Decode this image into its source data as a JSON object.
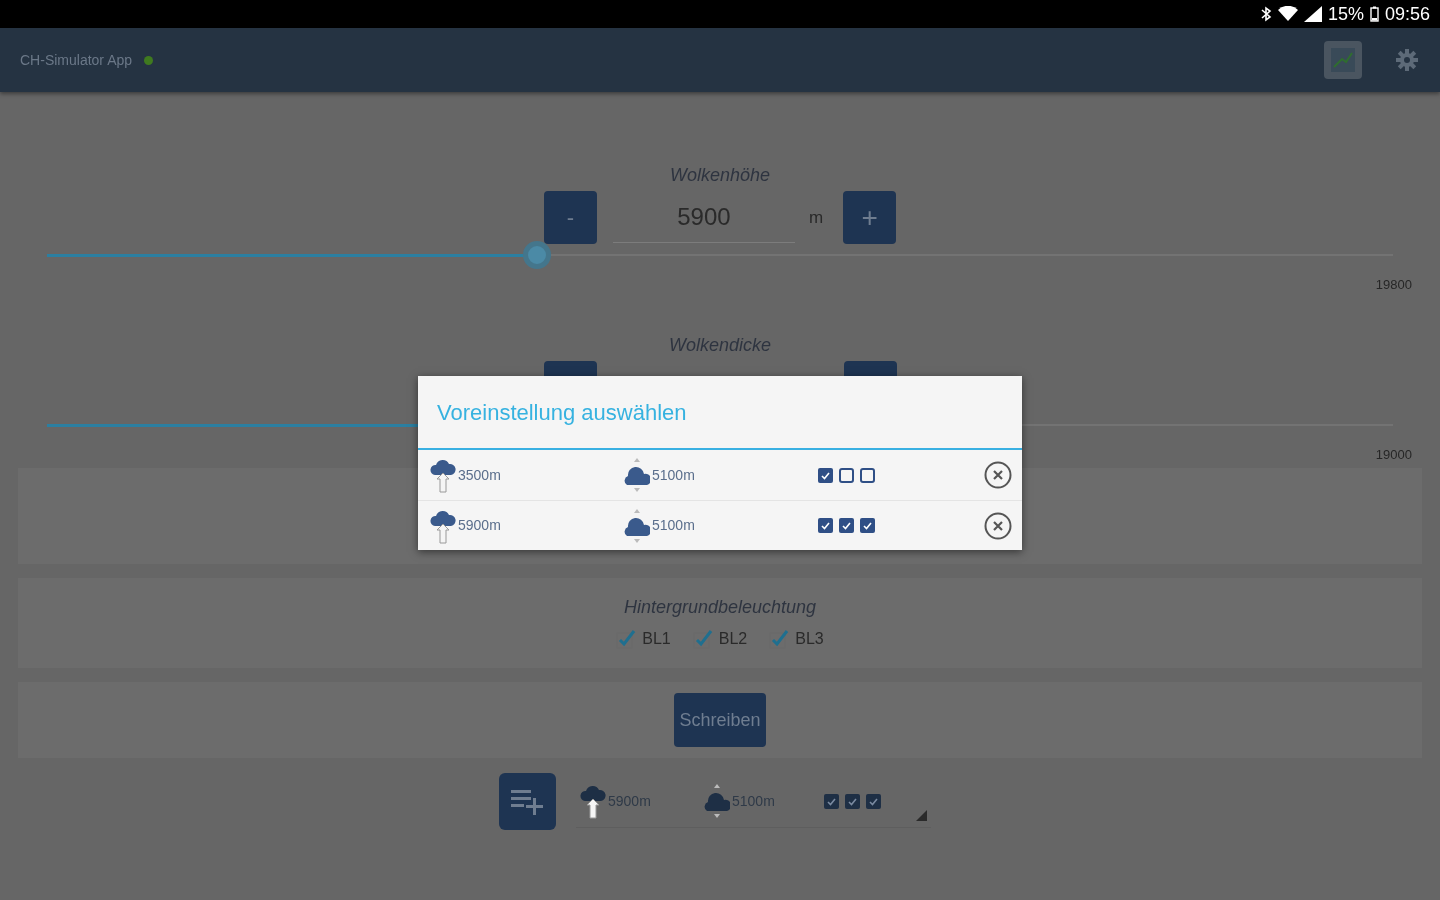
{
  "status_bar": {
    "battery": "15%",
    "time": "09:56"
  },
  "app_bar": {
    "title": "CH-Simulator App",
    "connected": true
  },
  "cloud_height": {
    "label": "Wolkenhöhe",
    "minus": "-",
    "value": "5900",
    "unit": "m",
    "plus": "+",
    "level": 0.364,
    "max": "19800"
  },
  "cloud_thickness": {
    "label": "Wolkendicke",
    "level": 0.3,
    "max": "19000"
  },
  "backlight": {
    "label": "Hintergrundbeleuchtung",
    "options": [
      {
        "label": "BL1",
        "checked": true
      },
      {
        "label": "BL2",
        "checked": true
      },
      {
        "label": "BL3",
        "checked": true
      }
    ]
  },
  "write_button": "Schreiben",
  "preset_bar": {
    "height": "5900m",
    "thickness": "5100m",
    "flags": [
      {
        "checked": true
      },
      {
        "checked": true
      },
      {
        "checked": true
      }
    ]
  },
  "dialog": {
    "title": "Voreinstellung auswählen",
    "presets": [
      {
        "height": "3500m",
        "thickness": "5100m",
        "flags": [
          {
            "checked": true
          },
          {
            "checked": false
          },
          {
            "checked": false
          }
        ]
      },
      {
        "height": "5900m",
        "thickness": "5100m",
        "flags": [
          {
            "checked": true
          },
          {
            "checked": true
          },
          {
            "checked": true
          }
        ]
      }
    ]
  }
}
